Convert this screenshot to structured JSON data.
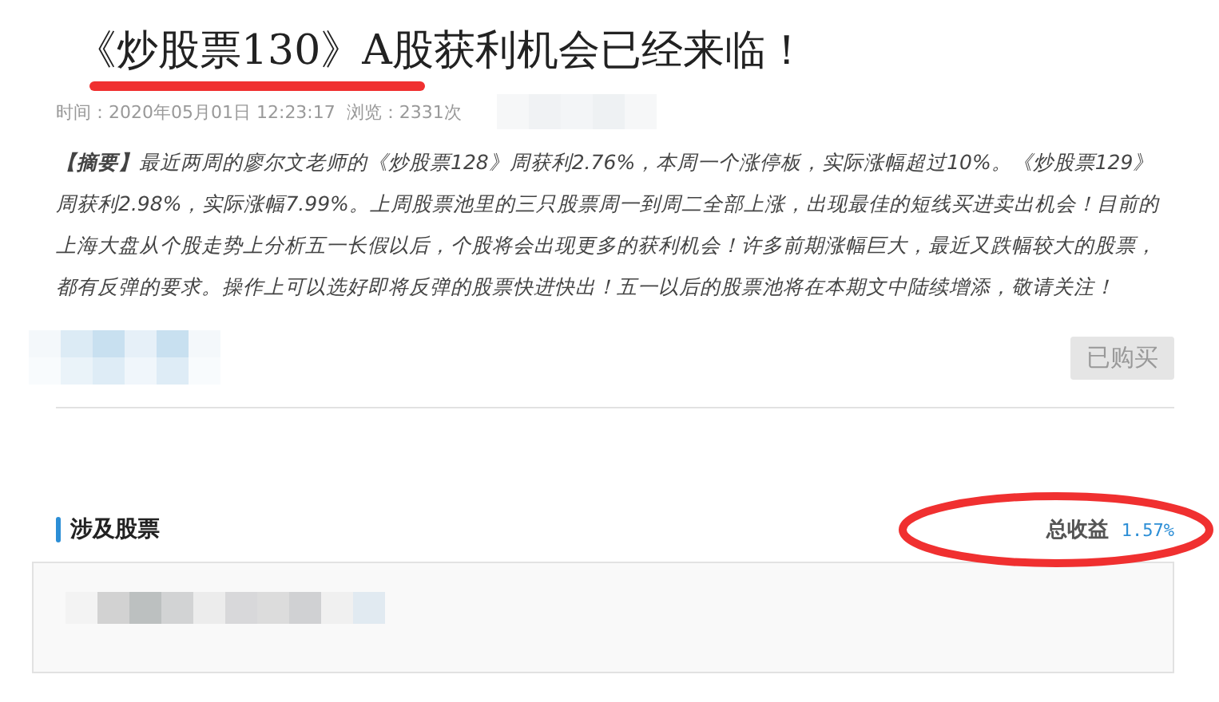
{
  "article": {
    "title": "《炒股票130》A股获利机会已经来临！",
    "meta": "时间：2020年05月01日 12:23:17  浏览：2331次",
    "summary": "**【摘要】**最近两周的廖尔文老师的《炒股票128》周获利2.76%，本周一个涨停板，实际涨幅超过10%。《炒股票129》周获利2.98%，实际涨幅7.99%。上周股票池里的三只股票周一到周二全部上涨，出现最佳的短线买进卖出机会！目前的上海大盘从个股走势上分析五一长假以后，个股将会出现更多的获利机会！许多前期涨幅巨大，最近又跌幅较大的股票，都有反弹的要求。操作上可以选好即将反弹的股票快进快出！五一以后的股票池将在本期文中陆续增添，敬请关注！",
    "purchase_button": {
      "label": "已购买",
      "disabled": true
    }
  },
  "stocks_section": {
    "title": "涉及股票",
    "total_label": "总收益",
    "total_value": "1.57%"
  }
}
